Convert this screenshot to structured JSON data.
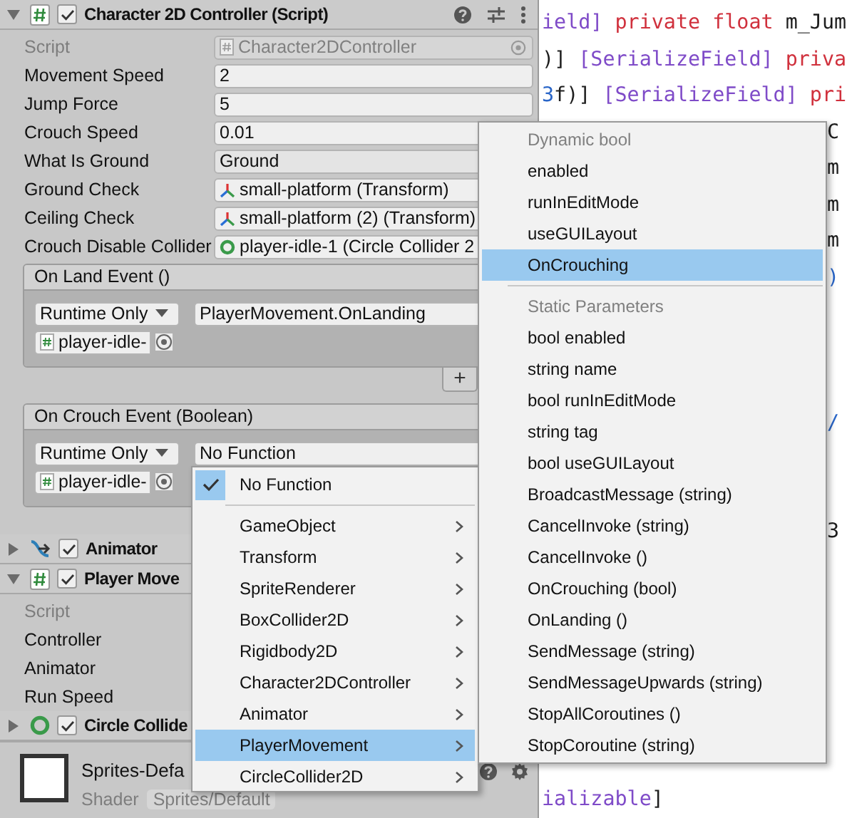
{
  "inspector": {
    "components": [
      {
        "kind": "script",
        "title": "Character 2D Controller (Script)",
        "expanded": true,
        "enabled": true,
        "header_tools": true,
        "fields": [
          {
            "label": "Script",
            "kind": "script_ref",
            "value": "Character2DController",
            "disabled": true
          },
          {
            "label": "Movement Speed",
            "kind": "text",
            "value": "2",
            "disabled": false
          },
          {
            "label": "Jump Force",
            "kind": "text",
            "value": "5",
            "disabled": false
          },
          {
            "label": "Crouch Speed",
            "kind": "text",
            "value": "0.01",
            "disabled": false
          },
          {
            "label": "What Is Ground",
            "kind": "dropdown",
            "value": "Ground",
            "disabled": false
          },
          {
            "label": "Ground Check",
            "kind": "transform",
            "value": "small-platform (Transform)",
            "disabled": false
          },
          {
            "label": "Ceiling Check",
            "kind": "transform",
            "value": "small-platform (2) (Transform)",
            "disabled": false
          },
          {
            "label": "Crouch Disable Collider",
            "kind": "collider",
            "value": "player-idle-1 (Circle Collider 2",
            "disabled": false
          }
        ],
        "events": [
          {
            "title": "On Land Event ()",
            "mode": "Runtime Only",
            "function": "PlayerMovement.OnLanding",
            "target": "player-idle-",
            "add": "+"
          },
          {
            "title": "On Crouch Event (Boolean)",
            "mode": "Runtime Only",
            "function": "No Function",
            "target": "player-idle-"
          }
        ]
      },
      {
        "kind": "animator",
        "title": "Animator",
        "expanded": false,
        "enabled": true
      },
      {
        "kind": "script",
        "title": "Player Move",
        "expanded": true,
        "enabled": true,
        "fields": [
          {
            "label": "Script",
            "kind": "label",
            "disabled": true
          },
          {
            "label": "Controller",
            "kind": "label",
            "disabled": false
          },
          {
            "label": "Animator",
            "kind": "label",
            "disabled": false
          },
          {
            "label": "Run Speed",
            "kind": "label",
            "disabled": false
          }
        ]
      },
      {
        "kind": "collider",
        "title": "Circle Collide",
        "expanded": false,
        "enabled": true
      }
    ],
    "material": {
      "name": "Sprites-Defa",
      "shader_label": "Shader",
      "shader": "Sprites/Default"
    }
  },
  "code_editor": {
    "lines": [
      {
        "kind": "full",
        "tokens": [
          {
            "text": "ield]",
            "kind": "attr"
          },
          {
            "text": " private float ",
            "kind": "keyword"
          },
          {
            "text": "m_Jum",
            "kind": "plain"
          }
        ]
      },
      {
        "kind": "full",
        "tokens": [
          {
            "text": ")] ",
            "kind": "plain"
          },
          {
            "text": "[SerializeField]",
            "kind": "attr"
          },
          {
            "text": " priva",
            "kind": "keyword"
          }
        ]
      },
      {
        "kind": "full",
        "tokens": [
          {
            "text": "3",
            "kind": "number"
          },
          {
            "text": "f)] ",
            "kind": "plain"
          },
          {
            "text": "[SerializeField]",
            "kind": "attr"
          },
          {
            "text": " pri",
            "kind": "keyword"
          }
        ]
      },
      {
        "kind": "edge",
        "tokens": [
          {
            "text": "C",
            "kind": "plain"
          }
        ]
      },
      {
        "kind": "edge",
        "tokens": [
          {
            "text": "m",
            "kind": "plain"
          }
        ]
      },
      {
        "kind": "edge",
        "tokens": [
          {
            "text": "m",
            "kind": "plain"
          }
        ]
      },
      {
        "kind": "edge",
        "tokens": [
          {
            "text": "m",
            "kind": "plain"
          }
        ]
      },
      {
        "kind": "edge",
        "tokens": [
          {
            "text": ")",
            "kind": "number"
          }
        ]
      },
      {
        "kind": "edge",
        "tokens": [
          {
            "text": "/",
            "kind": "number"
          }
        ]
      },
      {
        "kind": "edge",
        "tokens": [
          {
            "text": "3",
            "kind": "plain"
          }
        ]
      },
      {
        "kind": "tail",
        "tokens": [
          {
            "text": "ializable",
            "kind": "attr"
          },
          {
            "text": "]",
            "kind": "plain"
          }
        ]
      }
    ]
  },
  "function_menu": {
    "items": [
      {
        "kind": "item",
        "label": "No Function",
        "checked": true,
        "selected": false
      },
      {
        "kind": "separator"
      },
      {
        "kind": "submenu",
        "label": "GameObject",
        "checked": false,
        "selected": false
      },
      {
        "kind": "submenu",
        "label": "Transform",
        "checked": false,
        "selected": false
      },
      {
        "kind": "submenu",
        "label": "SpriteRenderer",
        "checked": false,
        "selected": false
      },
      {
        "kind": "submenu",
        "label": "BoxCollider2D",
        "checked": false,
        "selected": false
      },
      {
        "kind": "submenu",
        "label": "Rigidbody2D",
        "checked": false,
        "selected": false
      },
      {
        "kind": "submenu",
        "label": "Character2DController",
        "checked": false,
        "selected": false
      },
      {
        "kind": "submenu",
        "label": "Animator",
        "checked": false,
        "selected": false
      },
      {
        "kind": "submenu",
        "label": "PlayerMovement",
        "checked": false,
        "selected": true
      },
      {
        "kind": "submenu",
        "label": "CircleCollider2D",
        "checked": false,
        "selected": false
      }
    ]
  },
  "method_menu": {
    "items": [
      {
        "kind": "header",
        "label": "Dynamic bool"
      },
      {
        "kind": "item",
        "label": "enabled",
        "selected": false
      },
      {
        "kind": "item",
        "label": "runInEditMode",
        "selected": false
      },
      {
        "kind": "item",
        "label": "useGUILayout",
        "selected": false
      },
      {
        "kind": "item",
        "label": "OnCrouching",
        "selected": true
      },
      {
        "kind": "separator"
      },
      {
        "kind": "header",
        "label": "Static Parameters"
      },
      {
        "kind": "item",
        "label": "bool enabled",
        "selected": false
      },
      {
        "kind": "item",
        "label": "string name",
        "selected": false
      },
      {
        "kind": "item",
        "label": "bool runInEditMode",
        "selected": false
      },
      {
        "kind": "item",
        "label": "string tag",
        "selected": false
      },
      {
        "kind": "item",
        "label": "bool useGUILayout",
        "selected": false
      },
      {
        "kind": "item",
        "label": "BroadcastMessage (string)",
        "selected": false
      },
      {
        "kind": "item",
        "label": "CancelInvoke (string)",
        "selected": false
      },
      {
        "kind": "item",
        "label": "CancelInvoke ()",
        "selected": false
      },
      {
        "kind": "item",
        "label": "OnCrouching (bool)",
        "selected": false
      },
      {
        "kind": "item",
        "label": "OnLanding ()",
        "selected": false
      },
      {
        "kind": "item",
        "label": "SendMessage (string)",
        "selected": false
      },
      {
        "kind": "item",
        "label": "SendMessageUpwards (string)",
        "selected": false
      },
      {
        "kind": "item",
        "label": "StopAllCoroutines ()",
        "selected": false
      },
      {
        "kind": "item",
        "label": "StopCoroutine (string)",
        "selected": false
      }
    ]
  }
}
